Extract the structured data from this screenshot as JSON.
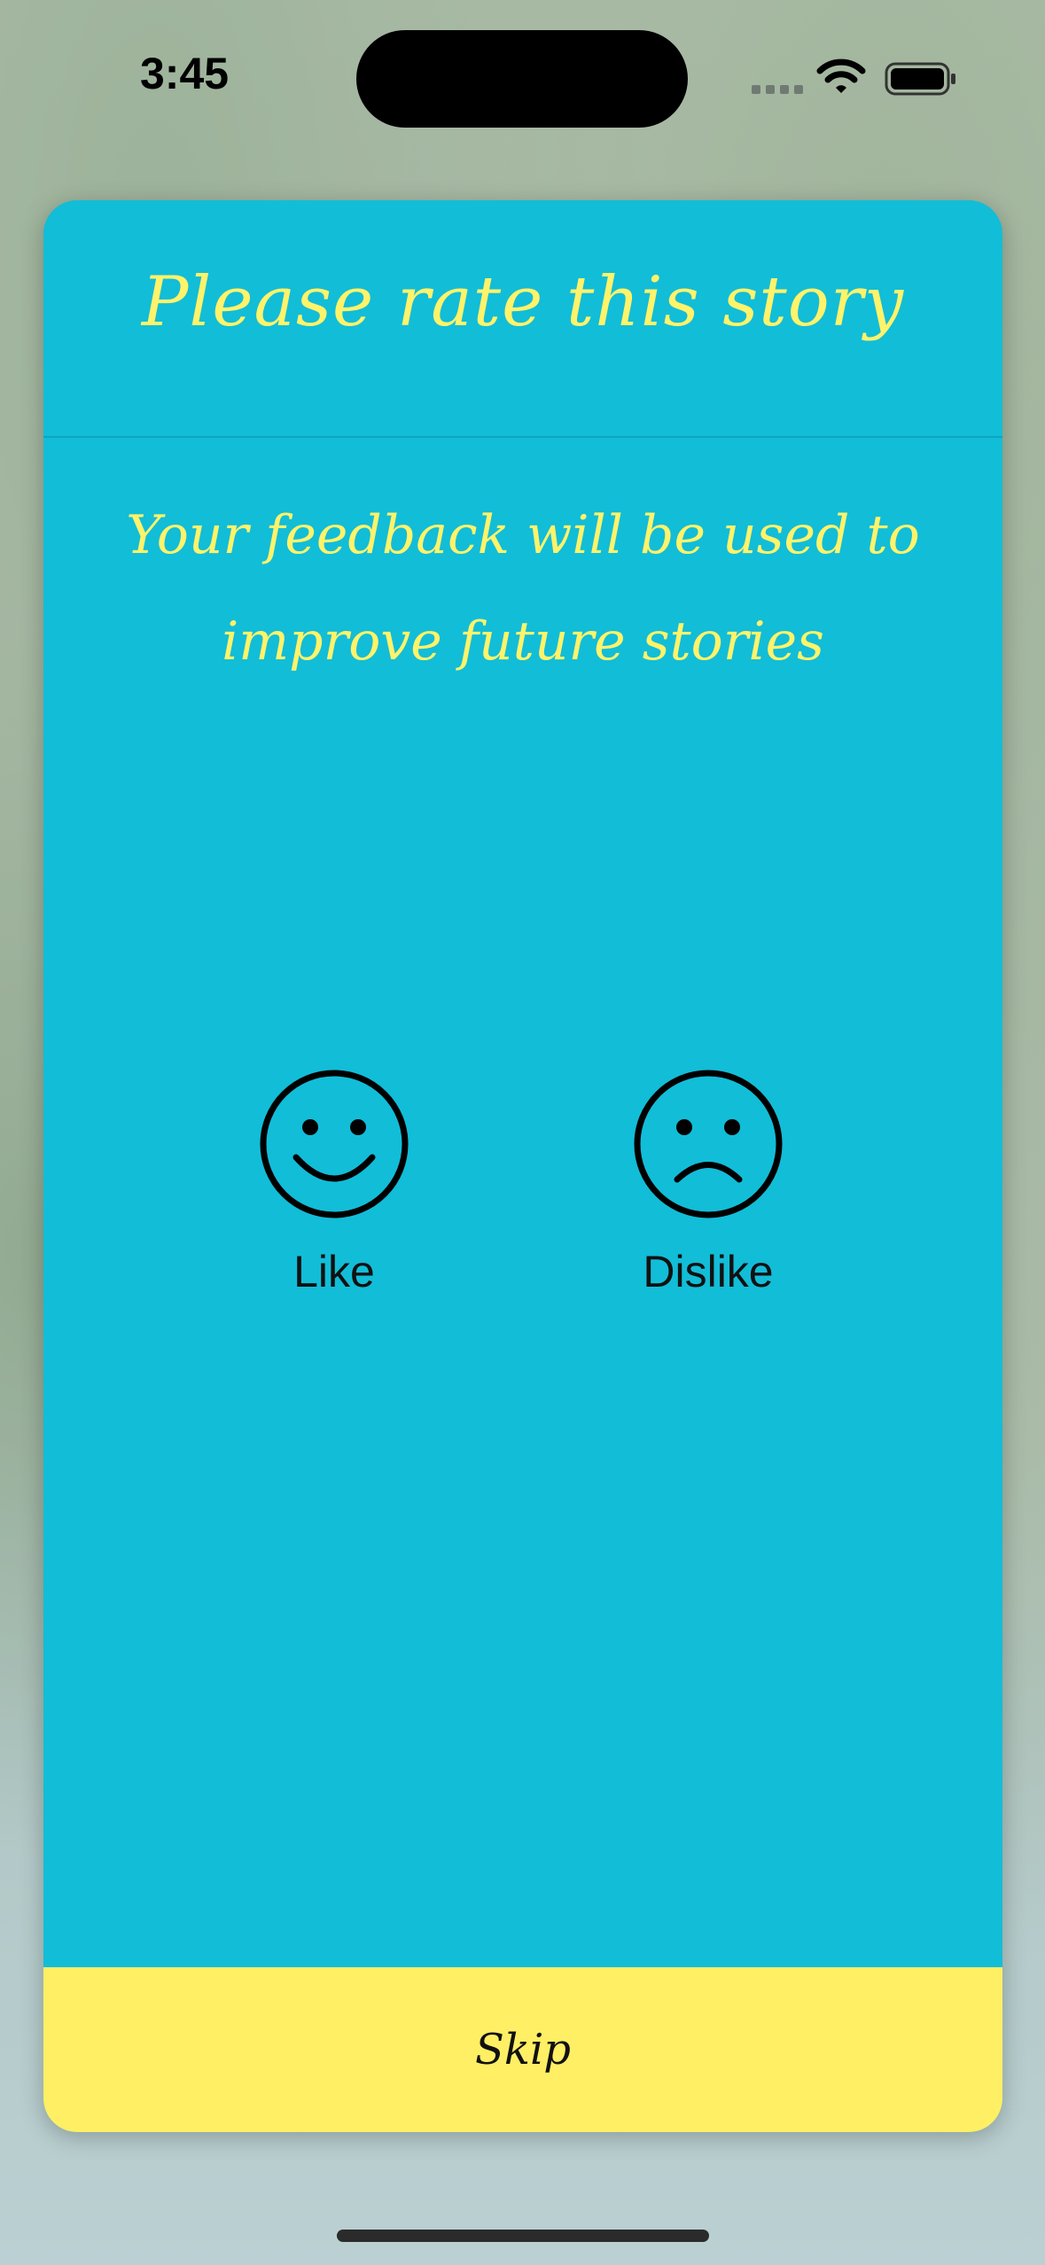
{
  "status_bar": {
    "time": "3:45"
  },
  "dialog": {
    "title": "Please rate this story",
    "subtitle_line1": "Your feedback will be used to",
    "subtitle_line2": "improve future stories",
    "like_label": "Like",
    "dislike_label": "Dislike",
    "skip_label": "Skip"
  },
  "icons": {
    "like": "smiley-face-icon",
    "dislike": "frowning-face-icon",
    "wifi": "wifi-icon",
    "battery": "battery-icon",
    "signal": "cellular-signal-icon"
  },
  "colors": {
    "card_background": "#12bdd8",
    "title_text": "#fff36a",
    "skip_background": "#ffef64"
  }
}
